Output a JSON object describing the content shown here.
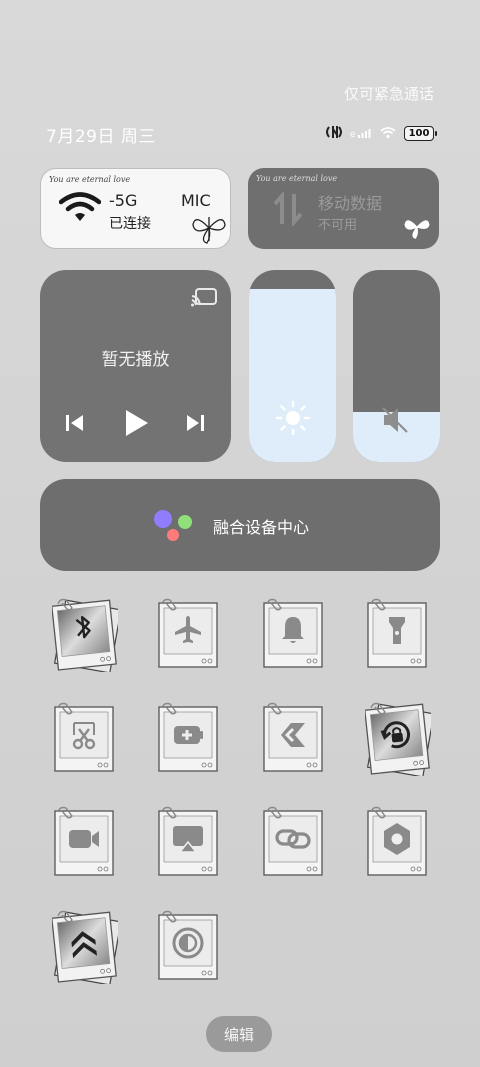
{
  "status": {
    "emergency_text": "仅可紧急通话",
    "date": "7月29日 周三",
    "battery": "100"
  },
  "wifi_card": {
    "decoration": "You are eternal love",
    "title_fragment": "-5G",
    "brand_fragment": "MIC",
    "status": "已连接"
  },
  "data_card": {
    "decoration": "You are eternal love",
    "title": "移动数据",
    "status": "不可用"
  },
  "media": {
    "title": "暂无播放"
  },
  "sliders": {
    "brightness_level": 0.9,
    "volume_level": 0.26
  },
  "hub": {
    "label": "融合设备中心"
  },
  "toggles": [
    {
      "name": "bluetooth",
      "icon": "bluetooth-icon",
      "active": true
    },
    {
      "name": "airplane",
      "icon": "airplane-icon",
      "active": false
    },
    {
      "name": "ringer",
      "icon": "bell-icon",
      "active": false
    },
    {
      "name": "flashlight",
      "icon": "flashlight-icon",
      "active": false
    },
    {
      "name": "screenshot",
      "icon": "scissors-icon",
      "active": false
    },
    {
      "name": "battery-saver",
      "icon": "battery-plus-icon",
      "active": false
    },
    {
      "name": "cast",
      "icon": "cast-arrow-icon",
      "active": false
    },
    {
      "name": "rotation-lock",
      "icon": "rotation-lock-icon",
      "active": true
    },
    {
      "name": "screen-record",
      "icon": "video-camera-icon",
      "active": false
    },
    {
      "name": "screen-share",
      "icon": "airplay-icon",
      "active": false
    },
    {
      "name": "link",
      "icon": "link-icon",
      "active": false
    },
    {
      "name": "settings-hex",
      "icon": "hexagon-nut-icon",
      "active": false
    },
    {
      "name": "performance",
      "icon": "double-chevron-up-icon",
      "active": true
    },
    {
      "name": "dark-mode",
      "icon": "contrast-icon",
      "active": false
    }
  ],
  "edit_button": {
    "label": "编辑"
  }
}
